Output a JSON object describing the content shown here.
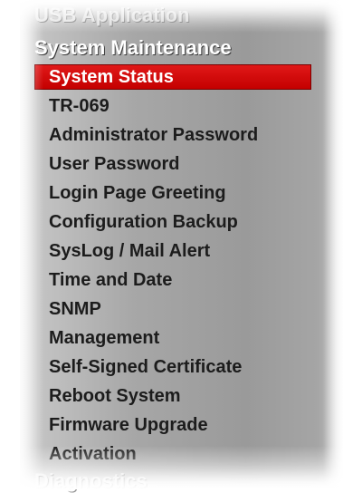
{
  "menu": {
    "prev_section": "USB Application",
    "section_title": "System Maintenance",
    "items": [
      {
        "label": "System Status",
        "selected": true
      },
      {
        "label": "TR-069"
      },
      {
        "label": "Administrator Password"
      },
      {
        "label": "User Password"
      },
      {
        "label": "Login Page Greeting"
      },
      {
        "label": "Configuration Backup"
      },
      {
        "label": "SysLog / Mail Alert"
      },
      {
        "label": "Time and Date"
      },
      {
        "label": "SNMP"
      },
      {
        "label": "Management"
      },
      {
        "label": "Self-Signed Certificate"
      },
      {
        "label": "Reboot System"
      },
      {
        "label": "Firmware Upgrade"
      },
      {
        "label": "Activation"
      }
    ],
    "next_section": "Diagnostics"
  },
  "colors": {
    "selected_bg": "#d40a0a",
    "menu_bg": "#a8a8a8",
    "item_text": "#1c1c1c"
  }
}
